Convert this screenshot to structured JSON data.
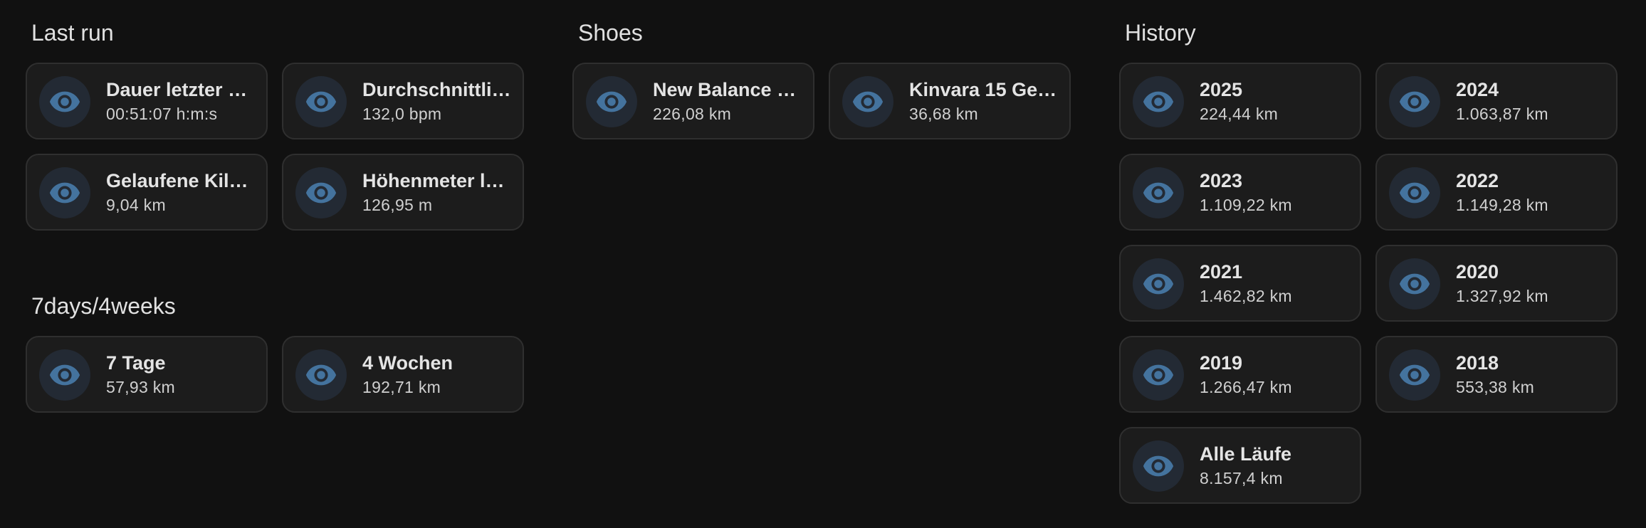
{
  "sections": {
    "last_run": {
      "title": "Last run",
      "tiles": [
        {
          "name": "Dauer letzter L…",
          "state": "00:51:07 h:m:s",
          "icon": "eye-icon"
        },
        {
          "name": "Durchschnittlic…",
          "state": "132,0 bpm",
          "icon": "eye-icon"
        },
        {
          "name": "Gelaufene Kilo…",
          "state": "9,04 km",
          "icon": "eye-icon"
        },
        {
          "name": "Höhenmeter le…",
          "state": "126,95 m",
          "icon": "eye-icon"
        }
      ]
    },
    "seven_days": {
      "title": "7days/4weeks",
      "tiles": [
        {
          "name": "7 Tage",
          "state": "57,93 km",
          "icon": "eye-icon"
        },
        {
          "name": "4 Wochen",
          "state": "192,71 km",
          "icon": "eye-icon"
        }
      ]
    },
    "shoes": {
      "title": "Shoes",
      "tiles": [
        {
          "name": "New Balance 1…",
          "state": "226,08 km",
          "icon": "eye-icon"
        },
        {
          "name": "Kinvara 15 Gel…",
          "state": "36,68 km",
          "icon": "eye-icon"
        }
      ]
    },
    "history": {
      "title": "History",
      "tiles": [
        {
          "name": "2025",
          "state": "224,44 km",
          "icon": "eye-icon"
        },
        {
          "name": "2024",
          "state": "1.063,87 km",
          "icon": "eye-icon"
        },
        {
          "name": "2023",
          "state": "1.109,22 km",
          "icon": "eye-icon"
        },
        {
          "name": "2022",
          "state": "1.149,28 km",
          "icon": "eye-icon"
        },
        {
          "name": "2021",
          "state": "1.462,82 km",
          "icon": "eye-icon"
        },
        {
          "name": "2020",
          "state": "1.327,92 km",
          "icon": "eye-icon"
        },
        {
          "name": "2019",
          "state": "1.266,47 km",
          "icon": "eye-icon"
        },
        {
          "name": "2018",
          "state": "553,38 km",
          "icon": "eye-icon"
        },
        {
          "name": "Alle Läufe",
          "state": "8.157,4 km",
          "icon": "eye-icon"
        }
      ]
    }
  },
  "colors": {
    "background": "#111111",
    "tile_background": "#1c1c1c",
    "tile_border": "#2f2f2f",
    "icon_color": "#44739e",
    "icon_circle": "#232a34"
  }
}
